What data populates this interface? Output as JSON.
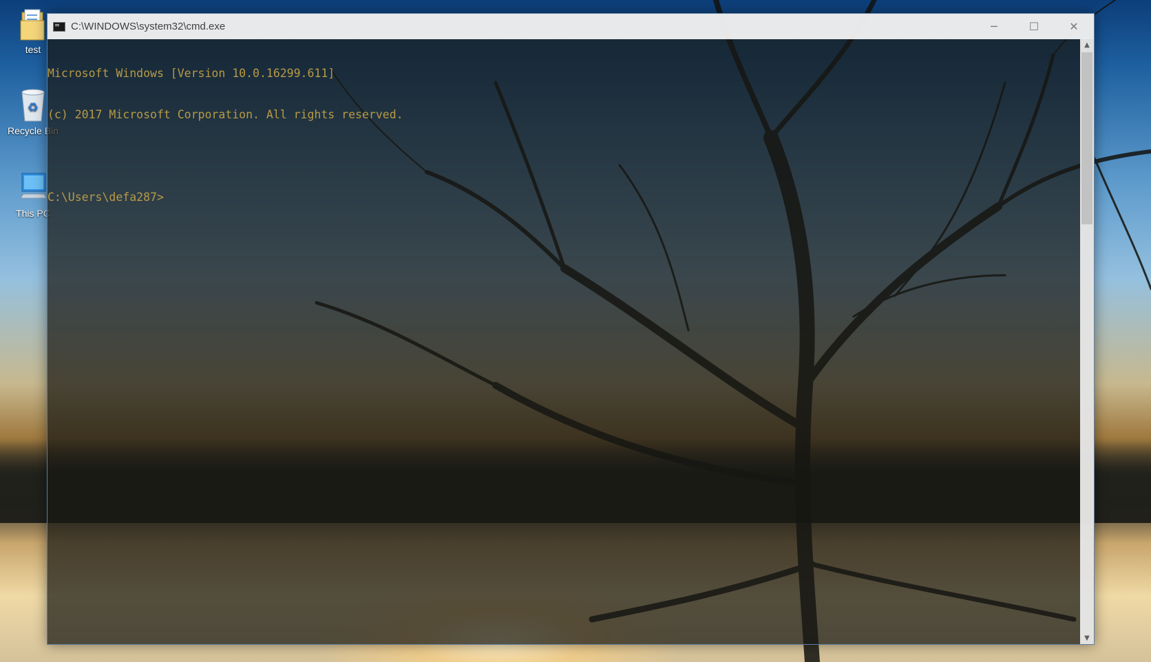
{
  "desktop": {
    "icons": [
      {
        "label": "test",
        "icon": "folder-icon"
      },
      {
        "label": "Recycle Bin",
        "icon": "recycle-bin-icon"
      },
      {
        "label": "This PC",
        "icon": "computer-icon"
      }
    ]
  },
  "window": {
    "title": "C:\\WINDOWS\\system32\\cmd.exe",
    "icon": "console-app-icon",
    "controls": {
      "minimize": "─",
      "maximize": "☐",
      "close": "✕"
    }
  },
  "console": {
    "lines": [
      "Microsoft Windows [Version 10.0.16299.611]",
      "(c) 2017 Microsoft Corporation. All rights reserved.",
      "",
      "C:\\Users\\defa287>"
    ],
    "text_color": "#b89a45"
  },
  "scrollbar": {
    "up_arrow": "▲",
    "down_arrow": "▼"
  }
}
